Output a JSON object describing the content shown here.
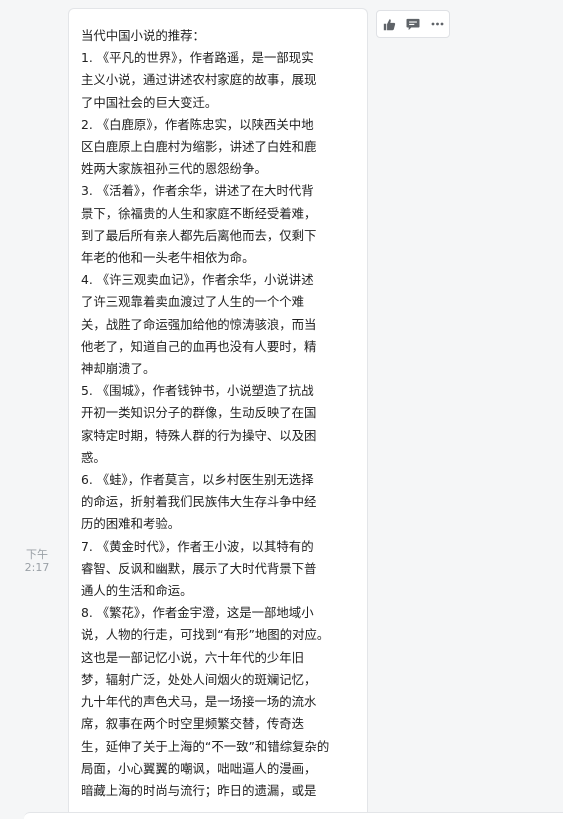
{
  "message": {
    "timestamp": [
      "下午",
      "2:17"
    ],
    "lines": [
      "当代中国小说的推荐：",
      "1. 《平凡的世界》，作者路遥，是一部现实",
      "主义小说，通过讲述农村家庭的故事，展现",
      "了中国社会的巨大变迁。",
      "2. 《白鹿原》，作者陈忠实，以陕西关中地",
      "区白鹿原上白鹿村为缩影，讲述了白姓和鹿",
      "姓两大家族祖孙三代的恩怨纷争。",
      "3. 《活着》，作者余华，讲述了在大时代背",
      "景下，徐福贵的人生和家庭不断经受着难，",
      "到了最后所有亲人都先后离他而去，仅剩下",
      "年老的他和一头老牛相依为命。",
      "4. 《许三观卖血记》，作者余华，小说讲述",
      "了许三观靠着卖血渡过了人生的一个个难",
      "关，战胜了命运强加给他的惊涛骇浪，而当",
      "他老了，知道自己的血再也没有人要时，精",
      "神却崩溃了。",
      "5. 《围城》，作者钱钟书，小说塑造了抗战",
      "开初一类知识分子的群像，生动反映了在国",
      "家特定时期，特殊人群的行为操守、以及困",
      "惑。",
      "6. 《蛙》，作者莫言，以乡村医生别无选择",
      "的命运，折射着我们民族伟大生存斗争中经",
      "历的困难和考验。",
      "7. 《黄金时代》，作者王小波，以其特有的",
      "睿智、反讽和幽默，展示了大时代背景下普",
      "通人的生活和命运。",
      "8. 《繁花》，作者金宇澄，这是一部地域小",
      "说，人物的行走，可找到“有形”地图的对应。",
      "这也是一部记忆小说，六十年代的少年旧",
      "梦，辐射广泛，处处人间烟火的斑斓记忆，",
      "九十年代的声色犬马，是一场接一场的流水",
      "席，叙事在两个时空里频繁交替，传奇迭",
      "生，延伸了关于上海的“不一致”和错综复杂的",
      "局面，小心翼翼的嘲讽，咄咄逼人的漫画，",
      "暗藏上海的时尚与流行；昨日的遗漏，或是"
    ]
  },
  "actions": [
    {
      "name": "like-button",
      "icon": "thumbs-up-icon"
    },
    {
      "name": "comment-button",
      "icon": "comment-icon"
    },
    {
      "name": "more-button",
      "icon": "more-horizontal-icon"
    }
  ],
  "colors": {
    "background": "#f5f6f7",
    "bubble": "#ffffff",
    "text": "#222222",
    "icon": "#5f6368",
    "timestamp": "#9aa0a6"
  }
}
